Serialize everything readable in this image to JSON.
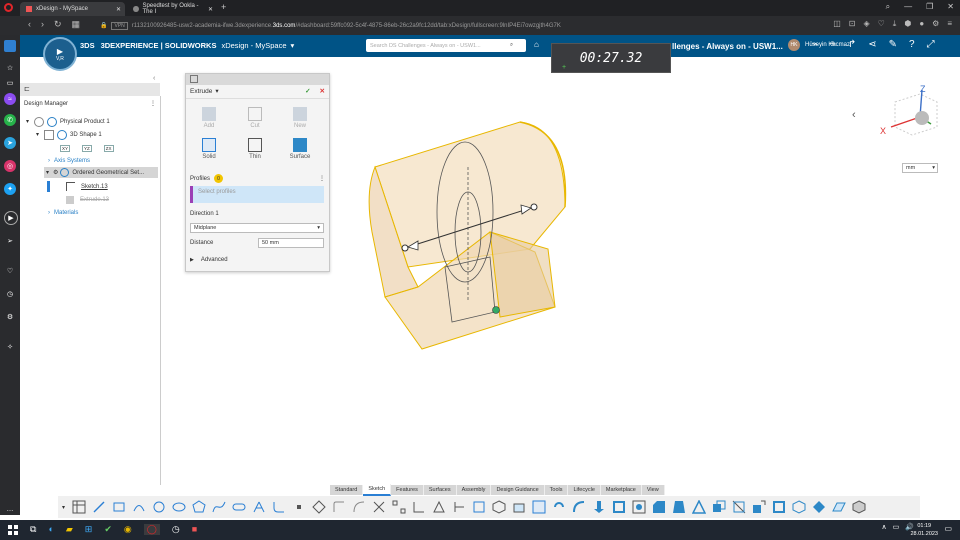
{
  "browser": {
    "tabs": [
      {
        "label": "xDesign - MySpace",
        "active": true
      },
      {
        "label": "Speedtest by Ookla - The I",
        "active": false
      }
    ],
    "url_prefix": "r1132100926485-usw2-academia-ifwe.3dexperience.",
    "url_domain": "3ds.com",
    "url_suffix": "/#dashboard:59ffc092-5c4f-4875-86eb-26c2a9fc12dd/tab:xDesign/fullscreen:9lnIP4Ei7owzgjth4G7K",
    "vpn_label": "VPN",
    "new_tab_label": "+"
  },
  "app": {
    "brand": "3DEXPERIENCE | SOLIDWORKS",
    "product": "xDesign - MySpace",
    "search_placeholder": "Search DS Challenges - Always on - USW1...",
    "tab_context": "llenges - Always on - USW1...",
    "user_name": "Hüseyin Kacmaz",
    "user_initials": "HK",
    "compass_label": "V,R"
  },
  "timer": {
    "value": "00:27.32"
  },
  "tree": {
    "header": "Design Manager",
    "items": [
      {
        "label": "Physical Product 1"
      },
      {
        "label": "3D Shape 1"
      },
      {
        "label": "XY"
      },
      {
        "label": "YZ"
      },
      {
        "label": "ZX"
      },
      {
        "label": "Axis Systems"
      },
      {
        "label": "Ordered Geometrical Set..."
      },
      {
        "label": "Sketch.13"
      },
      {
        "label": "Extrude.13"
      },
      {
        "label": "Materials"
      }
    ]
  },
  "extrude": {
    "title": "Extrude",
    "tools_top": [
      "Add",
      "Cut",
      "New"
    ],
    "tools_bottom": [
      "Solid",
      "Thin",
      "Surface"
    ],
    "profiles_label": "Profiles",
    "profiles_count": "0",
    "select_placeholder": "Select profiles",
    "direction_label": "Direction 1",
    "direction_value": "Midplane",
    "distance_label": "Distance",
    "distance_value": "50 mm",
    "advanced_label": "Advanced"
  },
  "viewport": {
    "axes": [
      "Z",
      "X"
    ],
    "units": "mm"
  },
  "ribbon": {
    "tabs": [
      "Standard",
      "Sketch",
      "Features",
      "Surfaces",
      "Assembly",
      "Design Guidance",
      "Tools",
      "Lifecycle",
      "Marketplace",
      "View"
    ],
    "active_tab": "Sketch"
  },
  "taskbar": {
    "time": "01:19",
    "date": "28.01.2023"
  },
  "colors": {
    "app_header": "#005386",
    "accent_yellow": "#e8b700",
    "extrude_shell": "#f2dcb8",
    "check_green": "#3a9a3a",
    "close_red": "#d33"
  }
}
